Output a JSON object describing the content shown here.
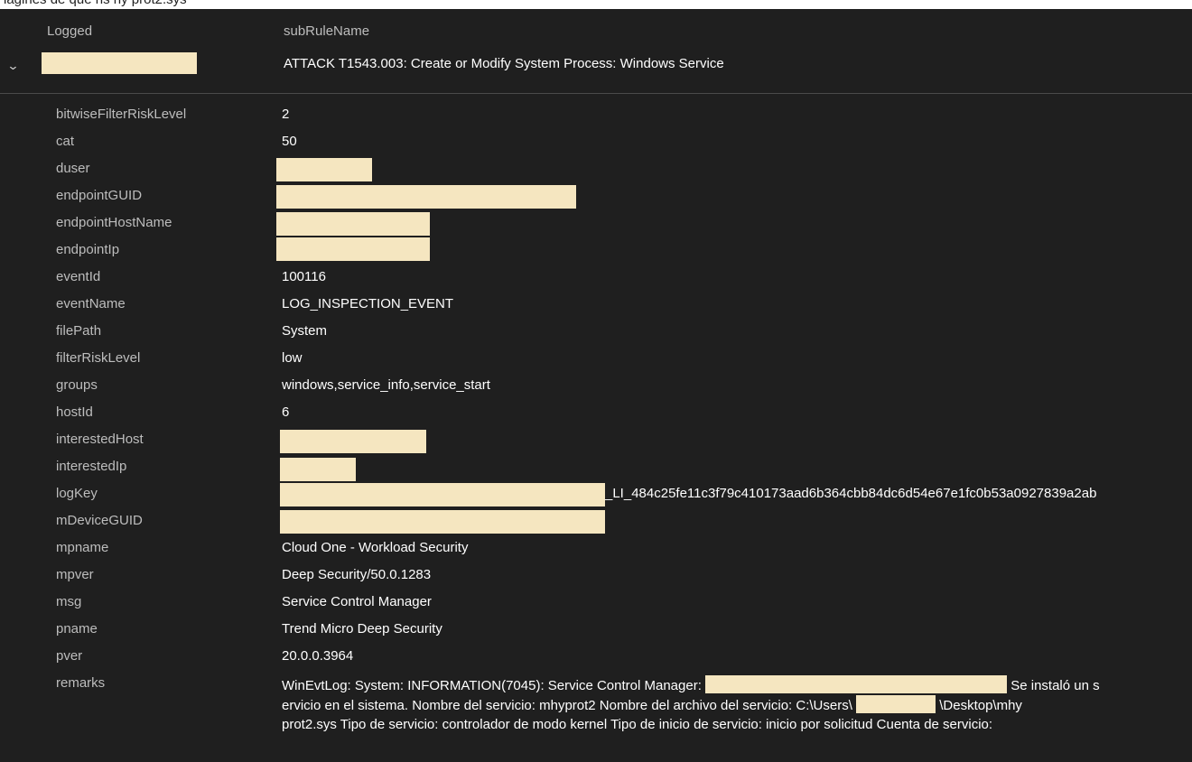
{
  "top_strip_text": "lagines de que hs     hy prot2.sys",
  "columns": {
    "logged": "Logged",
    "subRuleName": "subRuleName"
  },
  "event": {
    "subRuleName": "ATTACK T1543.003: Create or Modify System Process: Windows Service"
  },
  "fields": [
    {
      "key": "bitwiseFilterRiskLevel",
      "value": "2"
    },
    {
      "key": "cat",
      "value": "50"
    },
    {
      "key": "duser",
      "value": ""
    },
    {
      "key": "endpointGUID",
      "value": ""
    },
    {
      "key": "endpointHostName",
      "value": ""
    },
    {
      "key": "endpointIp",
      "value": ""
    },
    {
      "key": "eventId",
      "value": "100116"
    },
    {
      "key": "eventName",
      "value": "LOG_INSPECTION_EVENT"
    },
    {
      "key": "filePath",
      "value": "System"
    },
    {
      "key": "filterRiskLevel",
      "value": "low"
    },
    {
      "key": "groups",
      "value": "windows,service_info,service_start"
    },
    {
      "key": "hostId",
      "value": "6"
    },
    {
      "key": "interestedHost",
      "value": ""
    },
    {
      "key": "interestedIp",
      "value": ""
    },
    {
      "key": "logKey",
      "value": "_LI_484c25fe11c3f79c410173aad6b364cbb84dc6d54e67e1fc0b53a0927839a2ab"
    },
    {
      "key": "mDeviceGUID",
      "value": ""
    },
    {
      "key": "mpname",
      "value": "Cloud One - Workload Security"
    },
    {
      "key": "mpver",
      "value": "Deep Security/50.0.1283"
    },
    {
      "key": "msg",
      "value": "Service Control Manager"
    },
    {
      "key": "pname",
      "value": "Trend Micro Deep Security"
    },
    {
      "key": "pver",
      "value": "20.0.0.3964"
    },
    {
      "key": "remarks",
      "value": ""
    }
  ],
  "remarks": {
    "line1_a": "WinEvtLog: System: INFORMATION(7045): Service Control Manager:",
    "line1_b": "Se instaló un s",
    "line2_a": "ervicio en el sistema.   Nombre del servicio:  mhyprot2  Nombre del archivo del servicio:  C:\\Users\\",
    "line2_b": "\\Desktop\\mhy",
    "line3": "prot2.sys  Tipo de servicio:  controlador de modo kernel  Tipo de inicio de servicio:  inicio por solicitud  Cuenta de servicio:"
  }
}
